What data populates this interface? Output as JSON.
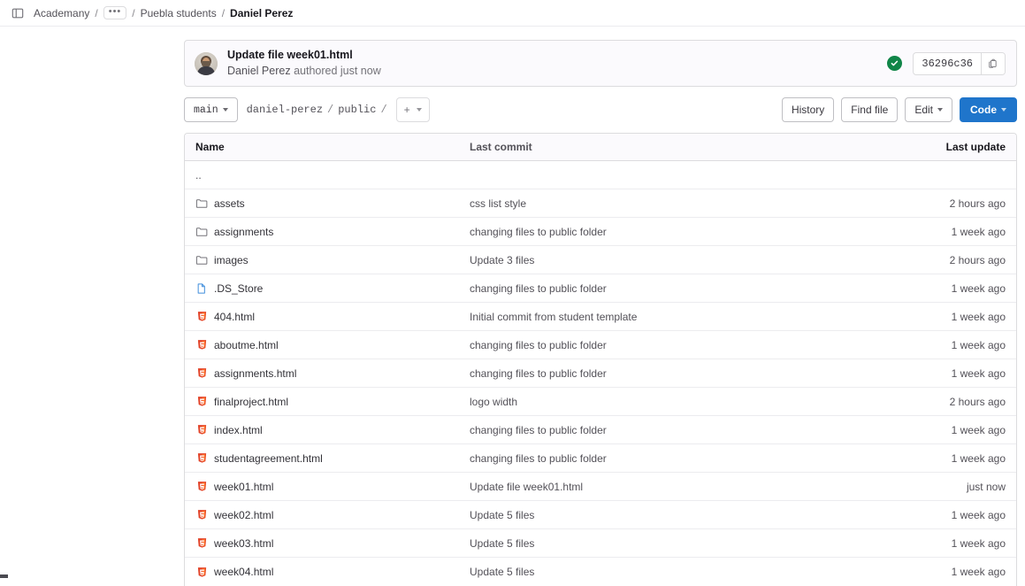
{
  "topbar": {
    "panel_toggle_name": "sidebar-toggle",
    "breadcrumb": {
      "root": "Academany",
      "ellipsis": "•••",
      "group": "Puebla students",
      "current": "Daniel Perez",
      "separator": "/"
    }
  },
  "commit": {
    "title": "Update file week01.html",
    "author": "Daniel Perez",
    "authored_text": "authored just now",
    "sha": "36296c36",
    "pipeline_status": "passed",
    "pipeline_color": "#108548",
    "copy_tooltip": "Copy commit SHA"
  },
  "toolbar": {
    "branch": "main",
    "path": [
      {
        "label": "daniel-perez"
      },
      {
        "label": "public"
      }
    ],
    "path_separator": "/",
    "add_label": "+",
    "history": "History",
    "find_file": "Find file",
    "edit": "Edit",
    "code": "Code",
    "primary_color": "#1f75cb"
  },
  "table": {
    "headers": {
      "name": "Name",
      "last_commit": "Last commit",
      "last_update": "Last update"
    },
    "parent_row": "..",
    "rows": [
      {
        "icon": "folder-icon",
        "type": "dir",
        "name": "assets",
        "commit": "css list style",
        "updated": "2 hours ago"
      },
      {
        "icon": "folder-icon",
        "type": "dir",
        "name": "assignments",
        "commit": "changing files to public folder",
        "updated": "1 week ago"
      },
      {
        "icon": "folder-icon",
        "type": "dir",
        "name": "images",
        "commit": "Update 3 files",
        "updated": "2 hours ago"
      },
      {
        "icon": "file-icon",
        "type": "file",
        "name": ".DS_Store",
        "commit": "changing files to public folder",
        "updated": "1 week ago"
      },
      {
        "icon": "html5-icon",
        "type": "html",
        "name": "404.html",
        "commit": "Initial commit from student template",
        "updated": "1 week ago"
      },
      {
        "icon": "html5-icon",
        "type": "html",
        "name": "aboutme.html",
        "commit": "changing files to public folder",
        "updated": "1 week ago"
      },
      {
        "icon": "html5-icon",
        "type": "html",
        "name": "assignments.html",
        "commit": "changing files to public folder",
        "updated": "1 week ago"
      },
      {
        "icon": "html5-icon",
        "type": "html",
        "name": "finalproject.html",
        "commit": "logo width",
        "updated": "2 hours ago"
      },
      {
        "icon": "html5-icon",
        "type": "html",
        "name": "index.html",
        "commit": "changing files to public folder",
        "updated": "1 week ago"
      },
      {
        "icon": "html5-icon",
        "type": "html",
        "name": "studentagreement.html",
        "commit": "changing files to public folder",
        "updated": "1 week ago"
      },
      {
        "icon": "html5-icon",
        "type": "html",
        "name": "week01.html",
        "commit": "Update file week01.html",
        "updated": "just now"
      },
      {
        "icon": "html5-icon",
        "type": "html",
        "name": "week02.html",
        "commit": "Update 5 files",
        "updated": "1 week ago"
      },
      {
        "icon": "html5-icon",
        "type": "html",
        "name": "week03.html",
        "commit": "Update 5 files",
        "updated": "1 week ago"
      },
      {
        "icon": "html5-icon",
        "type": "html",
        "name": "week04.html",
        "commit": "Update 5 files",
        "updated": "1 week ago"
      }
    ]
  }
}
